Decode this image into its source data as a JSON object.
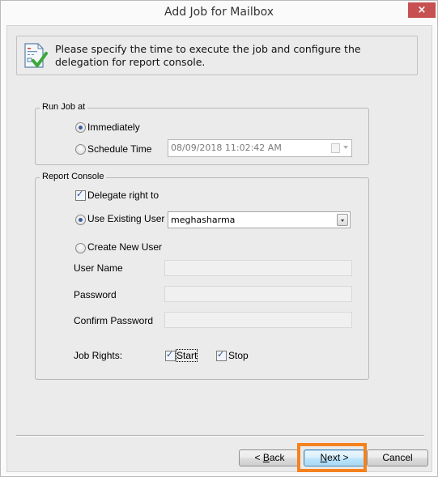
{
  "window": {
    "title": "Add Job for Mailbox",
    "close_label": "×"
  },
  "banner": {
    "icon": "document-checklist-check-icon",
    "line1": "Please specify the time to execute the job and configure the",
    "line2": "delegation for report console."
  },
  "run_job": {
    "legend": "Run Job at",
    "immediately_label": "Immediately",
    "immediately_selected": true,
    "schedule_label": "Schedule Time",
    "schedule_selected": false,
    "schedule_value": "08/09/2018 11:02:42 AM"
  },
  "report_console": {
    "legend": "Report Console",
    "delegate_label": "Delegate right to",
    "delegate_checked": true,
    "use_existing_label": "Use Existing User",
    "use_existing_selected": true,
    "existing_user_value": "meghasharma",
    "create_new_label": "Create New User",
    "create_new_selected": false,
    "user_name_label": "User Name",
    "user_name_value": "",
    "password_label": "Password",
    "password_value": "",
    "confirm_password_label": "Confirm Password",
    "confirm_password_value": "",
    "job_rights_label": "Job Rights:",
    "start_label": "Start",
    "start_checked": true,
    "stop_label": "Stop",
    "stop_checked": true
  },
  "footer": {
    "back_prefix": "< ",
    "back_mnemonic": "B",
    "back_rest": "ack",
    "next_mnemonic": "N",
    "next_rest": "ext >",
    "cancel_label": "Cancel",
    "highlight_color": "#f5821f"
  }
}
